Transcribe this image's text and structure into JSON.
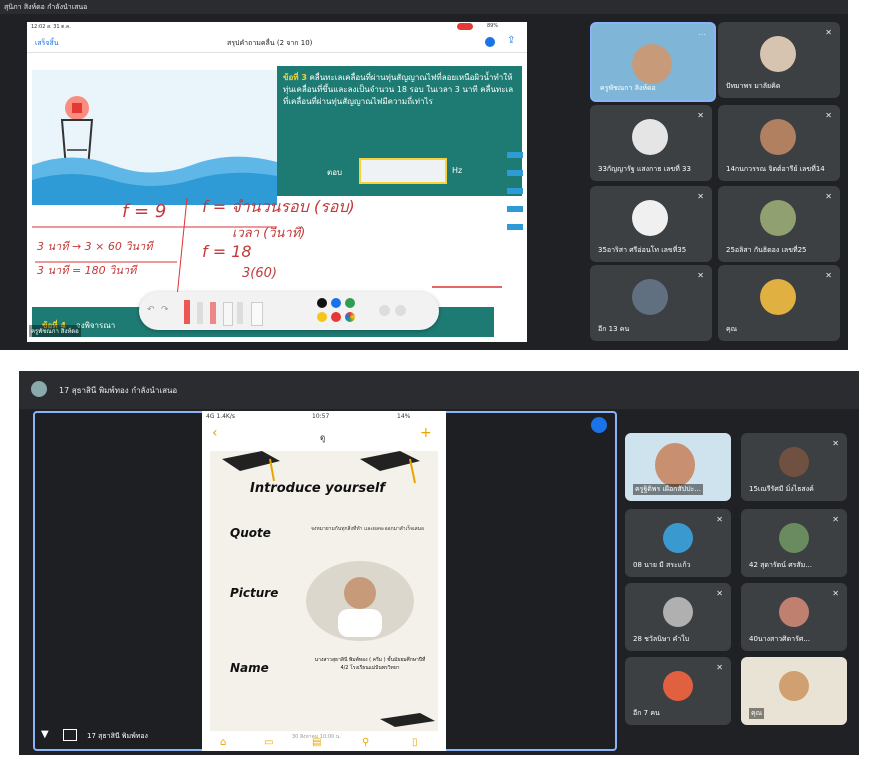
{
  "top": {
    "presenter_banner": "สุนิภา สิงห์ดอ กำลังนำเสนอ",
    "ipad": {
      "status_left": "12:02 ส. 31 ต.ค.",
      "status_right": "89%",
      "back_label": "เสร็จสิ้น",
      "doc_title": "สรุปคำถามคลื่น (2 จาก 10)",
      "question_no": "ข้อที่ 3",
      "question_text": "คลื่นทะเลเคลื่อนที่ผ่านทุ่นสัญญาณไฟที่ลอยเหนือผิวน้ำทำให้ทุ่นเคลื่อนที่ขึ้นและลงเป็นจำนวน 18 รอบ ในเวลา 3 นาที คลื่นทะเลที่เคลื่อนที่ผ่านทุ่นสัญญาณไฟมีความถี่เท่าไร",
      "answer_label": "ตอบ",
      "answer_unit": "Hz",
      "next_question": "ข้อที่ 4",
      "next_question_text": "จงพิจารณา",
      "presenter_caption": "ครูพัชณกา สิงห์ดอ",
      "handwriting": [
        "f = 9",
        "f = จำนวนรอบ (รอบ)",
        "เวลา (วินาที)",
        "3 นาที → 3 × 60 วินาที",
        "3 นาที = 180 วินาที",
        "f = 18",
        "3(60)"
      ]
    },
    "participants": [
      {
        "name": "ครูพัชณกา สิงห์ดอ",
        "color": "#7fb6d8",
        "avatar": "#c79a7a"
      },
      {
        "name": "ปัทมาพร มาลัยคิด",
        "color": "#3c4043",
        "avatar": "#d7c4b0"
      },
      {
        "name": "33กัญญารัฐ แสงกาธ เลขที่ 33",
        "color": "#3c4043",
        "avatar": "#e5e5e5"
      },
      {
        "name": "14กนกวรรณ จิตต์อารีย์ เลขที่14",
        "color": "#3c4043",
        "avatar": "#b08060"
      },
      {
        "name": "35อาริสา ศรีอ่อนโท เลขที่35",
        "color": "#3c4043",
        "avatar": "#f0f0f0"
      },
      {
        "name": "25อลิสา กันธิดอง เลขที่25",
        "color": "#3c4043",
        "avatar": "#90a070"
      },
      {
        "name": "อีก 13 คน",
        "color": "#3c4043",
        "avatar": "#607080"
      },
      {
        "name": "คุณ",
        "color": "#3c4043",
        "avatar": "#e0b040"
      }
    ]
  },
  "bottom": {
    "presenter_title": "17 สุธาสินี พิมพ์ทอง กำลังนำเสนอ",
    "phone": {
      "status_left": "4G 1.4K/s",
      "status_time": "10:57",
      "status_right": "14%",
      "back_icon": "‹",
      "title": "ดู",
      "add_icon": "+",
      "card_heading": "Introduce yourself",
      "quote_label": "Quote",
      "quote_text": "จงหมายามกันทุกสิ่งที่ทำ และผลจะออกมาสำเร็จเสมอ",
      "picture_label": "Picture",
      "name_label": "Name",
      "name_text": "นางสาวสุธาสินี พิมพ์ทอง ( ครีม ) ชั้นมัธยมศึกษาปีที่ 4/2 โรงเรียนแม่ปันพรวิทยา",
      "date_footer": "30 สิงหาคม 10:00 น."
    },
    "footer_name": "17 สุธาสินี พิมพ์ทอง",
    "participants": [
      {
        "name": "ครูฐิติพร เผือกสัปปะ...",
        "avatar": "#c89070"
      },
      {
        "name": "15เณรีรัศมี มิ่งไธสงค์",
        "avatar": "#705040"
      },
      {
        "name": "08 นาย มี สระแก้ว",
        "avatar": "#3a9ad0"
      },
      {
        "name": "42 สุดารัตน์ ศรสัม...",
        "avatar": "#6a8a60"
      },
      {
        "name": "28 ชวัลนิษา คำใบ",
        "avatar": "#b0b0b0"
      },
      {
        "name": "40นางสาวศิดารัศ...",
        "avatar": "#c08070"
      },
      {
        "name": "อีก 7 คน",
        "avatar": "#e06040"
      },
      {
        "name": "คุณ",
        "avatar": "#d0a070"
      }
    ]
  }
}
